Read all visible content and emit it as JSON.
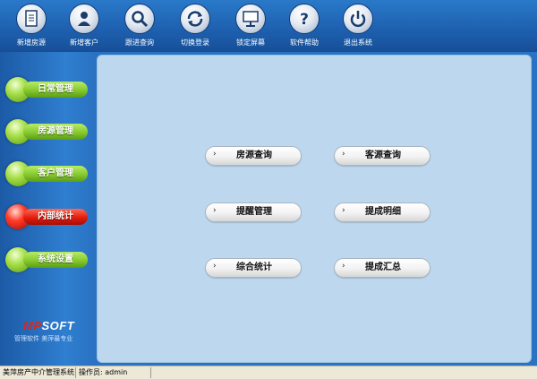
{
  "toolbar": {
    "items": [
      {
        "label": "新增房源",
        "icon": "document-icon"
      },
      {
        "label": "新增客户",
        "icon": "person-icon"
      },
      {
        "label": "跟进查询",
        "icon": "magnifier-icon"
      },
      {
        "label": "切换登录",
        "icon": "refresh-icon"
      },
      {
        "label": "锁定屏幕",
        "icon": "monitor-icon"
      },
      {
        "label": "软件帮助",
        "icon": "help-icon"
      },
      {
        "label": "退出系统",
        "icon": "power-icon"
      }
    ]
  },
  "sidebar": {
    "items": [
      {
        "label": "日常管理",
        "active": false
      },
      {
        "label": "房源管理",
        "active": false
      },
      {
        "label": "客户管理",
        "active": false
      },
      {
        "label": "内部统计",
        "active": true
      },
      {
        "label": "系统设置",
        "active": false
      }
    ],
    "logo": {
      "brand_mp": "MP",
      "brand_rest": "SOFT",
      "slogan": "管理软件 美萍最专业"
    }
  },
  "main": {
    "buttons": [
      {
        "label": "房源查询"
      },
      {
        "label": "客源查询"
      },
      {
        "label": "提醒管理"
      },
      {
        "label": "提成明细"
      },
      {
        "label": "综合统计"
      },
      {
        "label": "提成汇总"
      }
    ],
    "arrow": "›"
  },
  "statusbar": {
    "app_name": "美萍房产中介管理系统",
    "operator": "操作员: admin"
  },
  "colors": {
    "toolbar_bg": "#1d5fae",
    "sidebar_bg": "#2a73c2",
    "panel_bg": "#bdd8ee",
    "nav_green": "#86c92e",
    "nav_active_red": "#e21d0e"
  }
}
